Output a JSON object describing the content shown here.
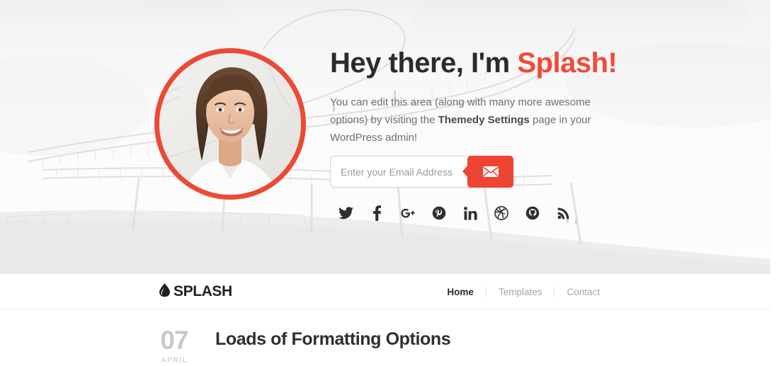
{
  "theme": {
    "accent": "#ee4433",
    "avatar_ring": "#ec4a35",
    "title_color": "#2b2b2b",
    "muted_text": "#6f6f6f"
  },
  "hero": {
    "title_plain": "Hey there, I'm ",
    "title_accent": "Splash!",
    "intro_part1": "You can edit this area (along with many more awesome options) by visiting the ",
    "intro_bold": "Themedy Settings",
    "intro_part2": " page in your WordPress admin!",
    "avatar_alt": "portrait-photo",
    "signup": {
      "placeholder": "Enter your Email Address",
      "value": "",
      "submit_icon": "envelope-icon"
    },
    "socials": [
      {
        "name": "twitter",
        "label": "Twitter"
      },
      {
        "name": "facebook",
        "label": "Facebook"
      },
      {
        "name": "googleplus",
        "label": "Google Plus"
      },
      {
        "name": "pinterest",
        "label": "Pinterest"
      },
      {
        "name": "linkedin",
        "label": "LinkedIn"
      },
      {
        "name": "dribbble",
        "label": "Dribbble"
      },
      {
        "name": "github",
        "label": "GitHub"
      },
      {
        "name": "rss",
        "label": "RSS"
      }
    ]
  },
  "nav": {
    "logo_text": "SPLASH",
    "logo_icon": "water-drop-icon",
    "links": [
      {
        "label": "Home",
        "active": true
      },
      {
        "label": "Templates",
        "active": false
      },
      {
        "label": "Contact",
        "active": false
      }
    ]
  },
  "post": {
    "day": "07",
    "month": "APRIL",
    "title": "Loads of Formatting Options"
  }
}
